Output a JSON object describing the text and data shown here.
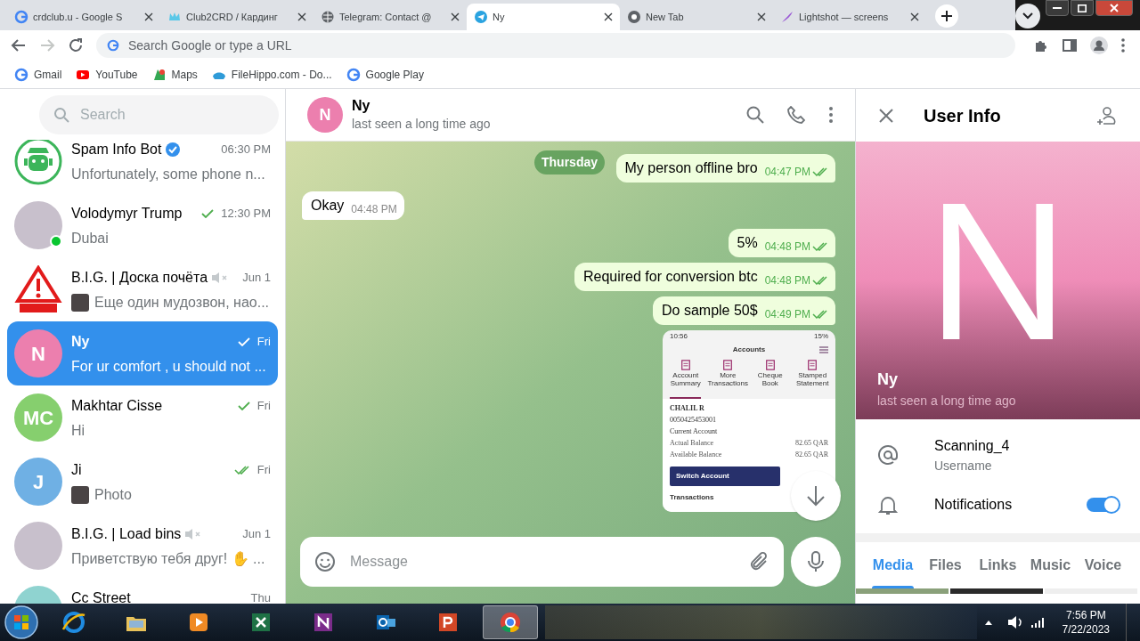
{
  "browser": {
    "tabs": [
      {
        "title": "crdclub.u - Google S",
        "selected": false
      },
      {
        "title": "Club2CRD / Кардинг",
        "selected": false
      },
      {
        "title": "Telegram: Contact @",
        "selected": false
      },
      {
        "title": "Ny",
        "selected": true
      },
      {
        "title": "New Tab",
        "selected": false
      },
      {
        "title": "Lightshot — screens",
        "selected": false
      }
    ],
    "address_bar": {
      "placeholder": "Search Google or type a URL"
    },
    "bookmarks": [
      {
        "label": "Gmail"
      },
      {
        "label": "YouTube"
      },
      {
        "label": "Maps"
      },
      {
        "label": "FileHippo.com - Do..."
      },
      {
        "label": "Google Play"
      }
    ]
  },
  "sidebar": {
    "search": {
      "placeholder": "Search"
    },
    "chats": [
      {
        "name": "Spam Info Bot",
        "time": "06:30 PM",
        "preview": "Unfortunately, some phone n...",
        "avatar": {
          "kind": "bot"
        },
        "sent": false,
        "read": false,
        "verified": true,
        "muted": false,
        "online": false,
        "thumb": false,
        "selected": false
      },
      {
        "name": "Volodymyr Trump",
        "time": "12:30 PM",
        "preview": "Dubai",
        "avatar": {
          "kind": "photo"
        },
        "sent": true,
        "read": false,
        "verified": false,
        "muted": false,
        "online": true,
        "thumb": false,
        "selected": false
      },
      {
        "name": "B.I.G. | Доска почёта",
        "time": "Jun 1",
        "preview": "Еще один мудозвон, нао...",
        "avatar": {
          "kind": "warning"
        },
        "sent": false,
        "read": false,
        "verified": false,
        "muted": true,
        "online": false,
        "thumb": true,
        "selected": false
      },
      {
        "name": "Ny",
        "time": "Fri",
        "preview": "For ur comfort , u should not ...",
        "avatar": {
          "kind": "initials",
          "initials": "N",
          "color": "#ec7fae"
        },
        "sent": true,
        "read": false,
        "verified": false,
        "muted": false,
        "online": false,
        "thumb": false,
        "selected": true
      },
      {
        "name": "Makhtar Cisse",
        "time": "Fri",
        "preview": "Hi",
        "avatar": {
          "kind": "initials",
          "initials": "MC",
          "color": "#86cf6e"
        },
        "sent": true,
        "read": false,
        "verified": false,
        "muted": false,
        "online": false,
        "thumb": false,
        "selected": false
      },
      {
        "name": "Ji",
        "time": "Fri",
        "preview": "Photo",
        "avatar": {
          "kind": "initials",
          "initials": "J",
          "color": "#6fb0e4"
        },
        "sent": true,
        "read": true,
        "verified": false,
        "muted": false,
        "online": false,
        "thumb": true,
        "selected": false
      },
      {
        "name": "B.I.G. | Load bins",
        "time": "Jun 1",
        "preview": "Приветствую тебя друг! ✋ ...",
        "avatar": {
          "kind": "photo"
        },
        "sent": false,
        "read": false,
        "verified": false,
        "muted": true,
        "online": false,
        "thumb": false,
        "selected": false
      },
      {
        "name": "Cc Street",
        "time": "Thu",
        "avatar": {
          "kind": "initials",
          "color": "#8fd3d0"
        },
        "sent": false,
        "read": false,
        "verified": false,
        "muted": false,
        "online": false,
        "thumb": false,
        "selected": false
      }
    ]
  },
  "chat": {
    "header": {
      "initials": "N",
      "name": "Ny",
      "status": "last seen a long time ago"
    },
    "date_badge": "Thursday",
    "messages": [
      {
        "kind": "text",
        "outgoing": true,
        "text": "My person offline bro",
        "time": "04:47 PM",
        "read": true
      },
      {
        "kind": "text",
        "outgoing": false,
        "text": "Okay",
        "time": "04:48 PM",
        "read": false
      },
      {
        "kind": "text",
        "outgoing": true,
        "text": "5%",
        "time": "04:48 PM",
        "read": true
      },
      {
        "kind": "text",
        "outgoing": true,
        "text": "Required for conversion btc",
        "time": "04:48 PM",
        "read": true
      },
      {
        "kind": "text",
        "outgoing": true,
        "text": "Do sample 50$",
        "time": "04:49 PM",
        "read": true
      },
      {
        "kind": "screenshot",
        "outgoing": true,
        "phone_time": "10:56",
        "battery": "15%",
        "title": "Accounts",
        "tabs": [
          {
            "label": "Account Summary",
            "selected": true
          },
          {
            "label": "More Transactions",
            "selected": false
          },
          {
            "label": "Cheque Book",
            "selected": false
          },
          {
            "label": "Stamped Statement",
            "selected": false
          }
        ],
        "holder": "CHALIL R",
        "account_number": "0050425453001",
        "account_type": "Current Account",
        "balances": [
          {
            "label": "Actual Balance",
            "value": "82.65 QAR"
          },
          {
            "label": "Available Balance",
            "value": "82.65 QAR"
          }
        ],
        "button": "Switch Account",
        "section": "Transactions"
      }
    ],
    "composer": {
      "placeholder": "Message"
    }
  },
  "user_info": {
    "title": "User Info",
    "initial": "N",
    "name": "Ny",
    "status": "last seen a long time ago",
    "username": {
      "value": "Scanning_4",
      "label": "Username"
    },
    "notifications": {
      "label": "Notifications",
      "on": true
    },
    "tabs": [
      {
        "label": "Media",
        "selected": true
      },
      {
        "label": "Files",
        "selected": false
      },
      {
        "label": "Links",
        "selected": false
      },
      {
        "label": "Music",
        "selected": false
      },
      {
        "label": "Voice",
        "selected": false
      }
    ]
  },
  "taskbar": {
    "apps": [
      {
        "kind": "ie",
        "selected": false
      },
      {
        "kind": "folder",
        "selected": false
      },
      {
        "kind": "media",
        "selected": false
      },
      {
        "kind": "excel",
        "selected": false
      },
      {
        "kind": "onenote",
        "selected": false
      },
      {
        "kind": "outlook",
        "selected": false
      },
      {
        "kind": "powerpoint",
        "selected": false
      },
      {
        "kind": "chrome",
        "selected": true
      }
    ],
    "time": "7:56 PM",
    "date": "7/22/2023"
  }
}
